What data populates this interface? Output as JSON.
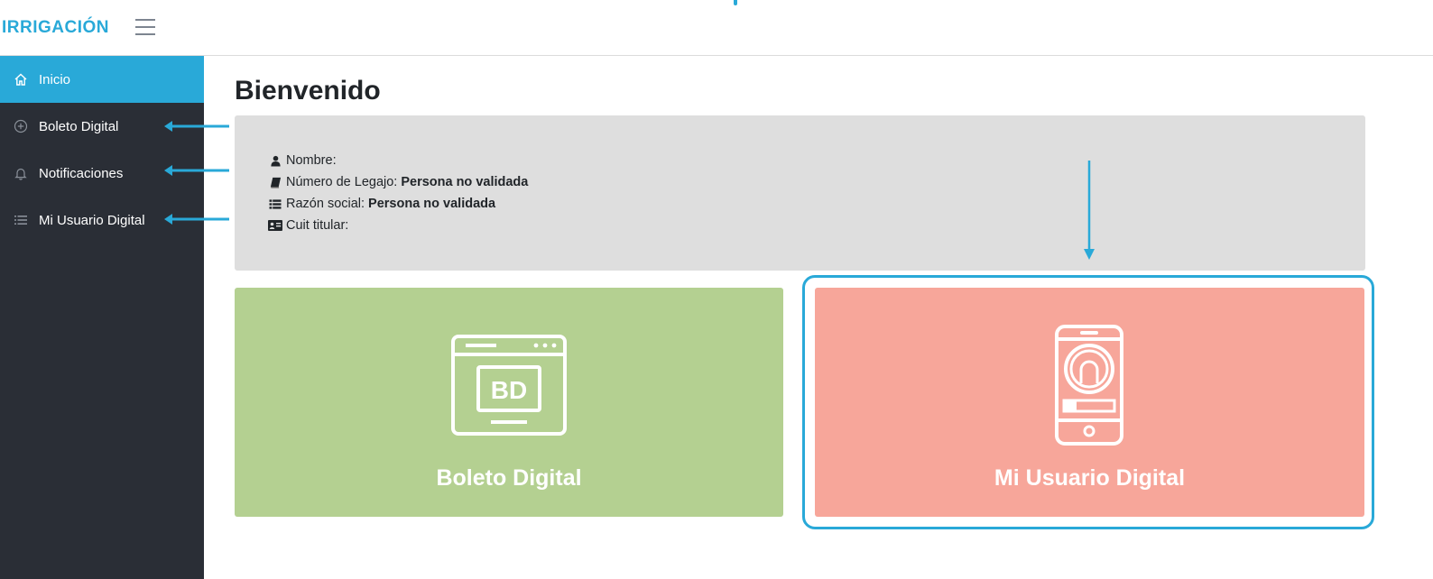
{
  "header": {
    "brand": "IRRIGACIÓN",
    "menu_icon": "hamburger-icon"
  },
  "sidebar": {
    "items": [
      {
        "label": "Inicio",
        "icon": "home-icon",
        "active": true
      },
      {
        "label": "Boleto Digital",
        "icon": "plus-circle-icon",
        "active": false
      },
      {
        "label": "Notificaciones",
        "icon": "bell-icon",
        "active": false
      },
      {
        "label": "Mi Usuario Digital",
        "icon": "list-icon",
        "active": false
      }
    ]
  },
  "main": {
    "title": "Bienvenido",
    "info": {
      "nombre_label": "Nombre:",
      "nombre_value": "",
      "legajo_label": "Número de Legajo:",
      "legajo_value": "Persona no validada",
      "razon_label": "Razón social:",
      "razon_value": "Persona no validada",
      "cuit_label": "Cuit titular:",
      "cuit_value": ""
    },
    "cards": [
      {
        "label": "Boleto Digital",
        "icon": "browser-bd-icon",
        "icon_text": "BD",
        "color": "#b4d091"
      },
      {
        "label": "Mi Usuario Digital",
        "icon": "smartphone-user-icon",
        "color": "#f7a69a"
      }
    ]
  },
  "colors": {
    "accent": "#29a9d8",
    "sidebar_bg": "#2a2e36",
    "panel_bg": "#dedede"
  }
}
